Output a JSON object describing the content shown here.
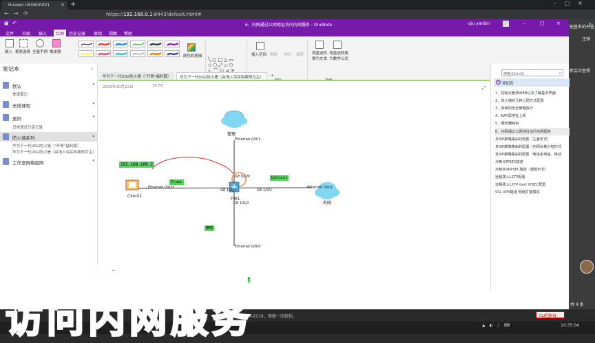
{
  "browser": {
    "tab_title": "Huawei USG6000V1",
    "url_prefix": "https://",
    "url_host": "192.168.0.1",
    "url_path": ":8443/default.html#"
  },
  "right_strip": {
    "item1": "他签名的书签",
    "item2": "注销",
    "item3": "新会中室得",
    "item4": "x",
    "count": "共 4 条"
  },
  "onenote": {
    "title": "6、内网通过公网地址访问内网服务 - OneNote",
    "user": "qiu yanbin",
    "menu": [
      "文件",
      "开始",
      "插入",
      "绘图",
      "历史记录",
      "审阅",
      "视图",
      "帮助"
    ],
    "active_menu_index": 3,
    "ribbon": {
      "tools": [
        "键入",
        "套索选择",
        "全量手柄",
        "橡皮擦"
      ],
      "pen_colors": [
        "#333333",
        "#e53935",
        "#1e88e5",
        "#43a047",
        "#333333",
        "#8e24aa",
        "#fdd835",
        "#ec407a",
        "#26c6da",
        "#888888",
        "#f57c00",
        "#3949ab"
      ],
      "color_thickness": "颜色和粗细",
      "insert_space": "插入空间",
      "delete": "删除",
      "arrange": "排列",
      "rotate": "旋转",
      "ink_to_text": "将墨迹转换为文本",
      "ink_to_math": "将墨迹转换为数学公式",
      "groups": {
        "tools": "工具",
        "shapes": "形状",
        "edit": "编辑",
        "convert": "转换"
      }
    },
    "notebook": {
      "header": "笔记本",
      "items": [
        {
          "label": "默认",
          "color": "#7b8ccc"
        },
        {
          "label": "无线课程",
          "color": "#7b8ccc"
        },
        {
          "label": "案例",
          "color": "#7b8ccc"
        },
        {
          "label": "防火墙系列",
          "color": "#7b8ccc"
        },
        {
          "label": "工作室网络组网",
          "color": "#7b8ccc"
        }
      ],
      "sub_default": "快速笔记",
      "sub_case": "日常调试分享记录",
      "sub_fw1": "华为下一代USG防火墙（\"开胃\"福利篇）",
      "sub_fw2": "华为下一代USG防火墙（由浅入深实际案例为主）"
    },
    "section_tabs": [
      "华为下一代USG防火墙（\"开胃\"福利篇）",
      "华为下一代USG防火墙（由浅入深实际案例为主）",
      "+"
    ],
    "page": {
      "date": "2020年10月22日",
      "time": "14:55"
    },
    "page_list": {
      "search_placeholder": "搜索(Ctrl+E)",
      "add_page": "添加页",
      "pages": [
        "1、初始化登录WEB以及了解基本界面",
        "2、防火墙的几种上网方式配置",
        "3、简单的安全策略放行",
        "4、NAT源地址上网",
        "5、服务器映射",
        "6、内网通过公网地址访问内网服务",
        "多ISP策略路由的配置（主备形式）",
        "多ISP策略路由的配置（内网负载分担形式",
        "多ISP策略路由的配置（电信走电信、移动",
        "点到点IPSEC隧道",
        "点到多点IPSEC隧道（模板形式）",
        "远程拨入L2TP配置",
        "远程拨入L2TP over IPSEC配置",
        "SSL VPN隧道 网络扩展模式"
      ],
      "selected_index": 5
    }
  },
  "diagram": {
    "mgmt_label": "管理",
    "mgmt_port": "Ethernet 0/0/1",
    "fw_label": "FW1",
    "fw_ports": [
      "GE 0/0/0",
      "GE 1/0/0",
      "GE 1/0/1",
      "GE 1/0/2"
    ],
    "client_label": "Client1",
    "client_port": "Ethernet 0/0/0",
    "ext_label": "外网",
    "ext_port": "Ethernet 0/0/1",
    "dmz_port": "Ethernet 0/0/0",
    "ip_tag": "192.168.100.2",
    "trust_tag": "Trust",
    "untrust_tag": "Untrust",
    "dmz_tag": "DMZ",
    "bottom_tag": "2"
  },
  "overlay": {
    "line1": "内网通过公网地址",
    "line2": "访问内网服务"
  },
  "footer": {
    "text": "2014-2018，保留一切权利。",
    "cli": "CLI控制台",
    "clock": "10:35:04"
  }
}
